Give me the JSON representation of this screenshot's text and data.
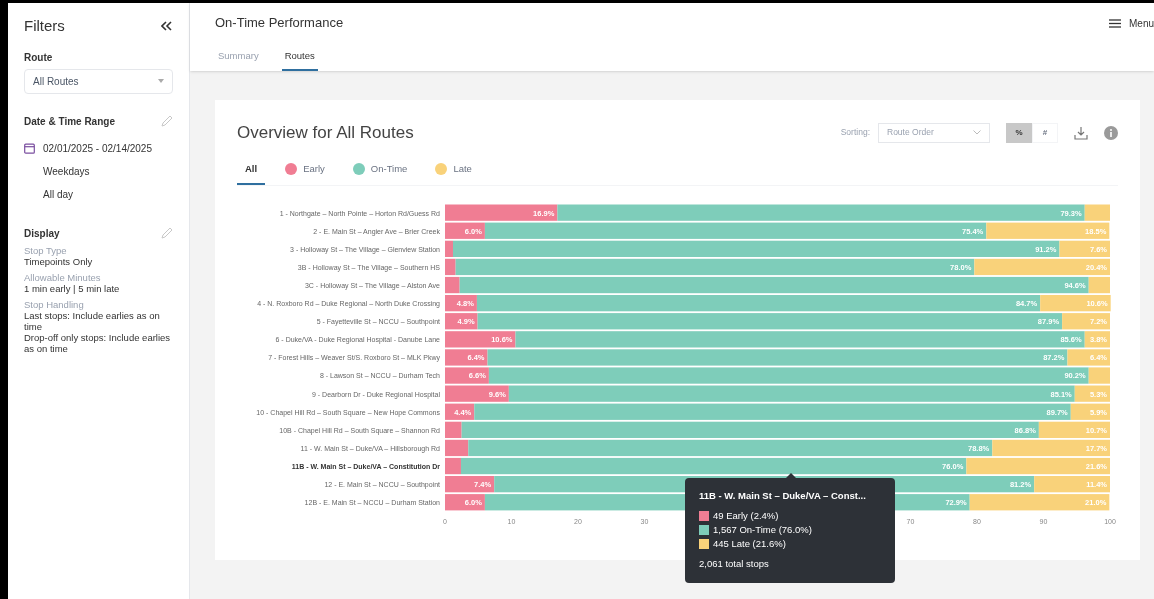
{
  "sidebar": {
    "title": "Filters",
    "route": {
      "label": "Route",
      "value": "All Routes"
    },
    "date_range": {
      "label": "Date & Time Range",
      "dates": "02/01/2025 - 02/14/2025",
      "days": "Weekdays",
      "time": "All day"
    },
    "display": {
      "label": "Display",
      "settings": [
        {
          "name": "Stop Type",
          "value": "Timepoints Only"
        },
        {
          "name": "Allowable Minutes",
          "value": "1 min early | 5 min late"
        },
        {
          "name": "Stop Handling",
          "value": "Last stops: Include earlies as on time\nDrop-off only stops: Include earlies as on time"
        }
      ]
    }
  },
  "header": {
    "title": "On-Time Performance",
    "menu": "Menu",
    "tabs": [
      {
        "label": "Summary",
        "selected": false
      },
      {
        "label": "Routes",
        "selected": true
      }
    ]
  },
  "card": {
    "title": "Overview for All Routes",
    "sorting_label": "Sorting:",
    "sorting_value": "Route Order",
    "units": [
      {
        "label": "%",
        "selected": true
      },
      {
        "label": "#",
        "selected": false
      }
    ],
    "filters": [
      {
        "kind": "all",
        "label": "All",
        "selected": true
      },
      {
        "kind": "series",
        "selected": false
      },
      {
        "kind": "series",
        "selected": false
      },
      {
        "kind": "series",
        "selected": false
      }
    ],
    "chart_data": {
      "type": "bar",
      "orientation": "horizontal",
      "stacked": true,
      "categories": [
        "1 - Northgate – North Pointe – Horton Rd/Guess Rd",
        "2 - E. Main St – Angier Ave – Brier Creek",
        "3 - Holloway St – The Village – Glenview Station",
        "3B - Holloway St – The Village – Southern HS",
        "3C - Holloway St – The Village – Alston Ave",
        "4 - N. Roxboro Rd – Duke Regional – North Duke Crossing",
        "5 - Fayetteville St – NCCU – Southpoint",
        "6 - Duke/VA - Duke Regional Hospital - Danube Lane",
        "7 - Forest Hills – Weaver St/S. Roxboro St – MLK Pkwy",
        "8 - Lawson St – NCCU – Durham Tech",
        "9 - Dearborn Dr - Duke Regional Hospital",
        "10 - Chapel Hill Rd – South Square – New Hope Commons",
        "10B - Chapel Hill Rd – South Square – Shannon Rd",
        "11 - W. Main St – Duke/VA – Hillsborough Rd",
        "11B - W. Main St – Duke/VA – Constitution Dr",
        "12 - E. Main St – NCCU – Southpoint",
        "12B - E. Main St – NCCU – Durham Station"
      ],
      "series": [
        {
          "name": "Early",
          "color": "#f07d93",
          "values": [
            16.9,
            6.0,
            1.2,
            1.6,
            2.2,
            4.8,
            4.9,
            10.6,
            6.4,
            6.6,
            9.6,
            4.4,
            2.5,
            3.5,
            2.4,
            7.4,
            6.0
          ]
        },
        {
          "name": "On-Time",
          "color": "#7ecdba",
          "values": [
            79.3,
            75.4,
            91.2,
            78.0,
            94.6,
            84.7,
            87.9,
            85.6,
            87.2,
            90.2,
            85.1,
            89.7,
            86.8,
            78.8,
            76.0,
            81.2,
            72.9
          ]
        },
        {
          "name": "Late",
          "color": "#f9d27a",
          "values": [
            3.8,
            18.5,
            7.6,
            20.4,
            3.2,
            10.6,
            7.2,
            3.8,
            6.4,
            3.2,
            5.3,
            5.9,
            10.7,
            17.7,
            21.6,
            11.4,
            21.0
          ]
        }
      ],
      "value_labels": [
        [
          "16.9%",
          "6.0%",
          null,
          null,
          null,
          "4.8%",
          "4.9%",
          "10.6%",
          "6.4%",
          "6.6%",
          "9.6%",
          "4.4%",
          null,
          null,
          null,
          "7.4%",
          "6.0%"
        ],
        [
          "79.3%",
          "75.4%",
          "91.2%",
          "78.0%",
          "94.6%",
          "84.7%",
          "87.9%",
          "85.6%",
          "87.2%",
          "90.2%",
          "85.1%",
          "89.7%",
          "86.8%",
          "78.8%",
          "76.0%",
          "81.2%",
          "72.9%"
        ],
        [
          null,
          "18.5%",
          "7.6%",
          "20.4%",
          null,
          "10.6%",
          "7.2%",
          "3.8%",
          "6.4%",
          null,
          "5.3%",
          "5.9%",
          "10.7%",
          "17.7%",
          "21.6%",
          "11.4%",
          "21.0%"
        ]
      ],
      "xlim": [
        0,
        100
      ],
      "xticks": [
        0,
        10,
        20,
        30,
        70,
        80,
        90,
        100
      ]
    },
    "row_states": [
      {
        "selected": false
      },
      {
        "selected": false
      },
      {
        "selected": false
      },
      {
        "selected": false
      },
      {
        "selected": false
      },
      {
        "selected": false
      },
      {
        "selected": false
      },
      {
        "selected": false
      },
      {
        "selected": false
      },
      {
        "selected": false
      },
      {
        "selected": false
      },
      {
        "selected": false
      },
      {
        "selected": false
      },
      {
        "selected": false
      },
      {
        "selected": true
      },
      {
        "selected": false
      },
      {
        "selected": false
      }
    ],
    "tooltip": {
      "title": "11B - W. Main St – Duke/VA – Const...",
      "items": [
        {
          "text": "49 Early (2.4%)",
          "color": "#f07d93"
        },
        {
          "text": "1,567 On-Time (76.0%)",
          "color": "#7ecdba"
        },
        {
          "text": "445 Late (21.6%)",
          "color": "#f9d27a"
        }
      ],
      "total": "2,061 total stops"
    }
  }
}
